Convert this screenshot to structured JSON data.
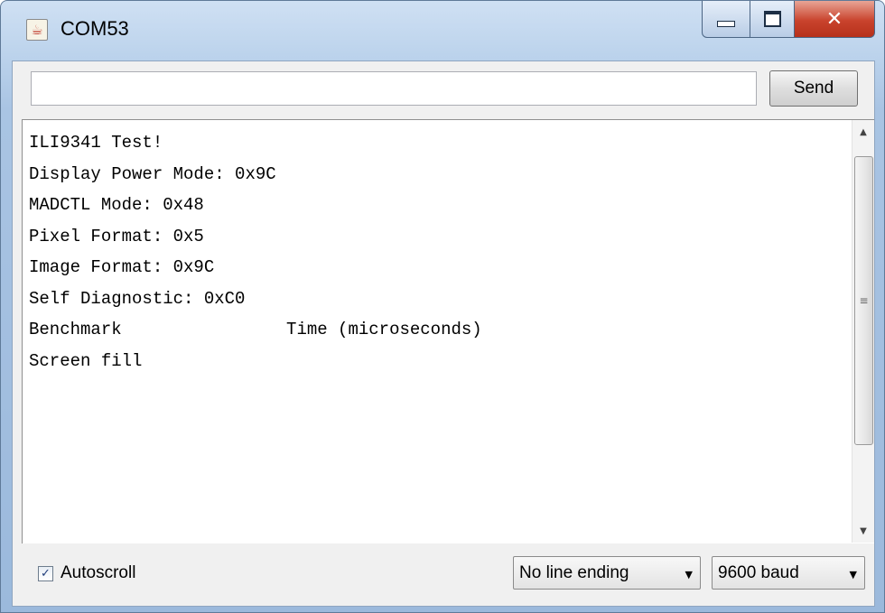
{
  "window": {
    "title": "COM53",
    "app_icon": "java-coffee-icon",
    "controls": {
      "minimize": "minimize-icon",
      "maximize": "maximize-icon",
      "close": "✕"
    }
  },
  "input": {
    "value": "",
    "placeholder": ""
  },
  "send_button": {
    "label": "Send"
  },
  "output": {
    "lines": [
      "ILI9341 Test!",
      "Display Power Mode: 0x9C",
      "MADCTL Mode: 0x48",
      "Pixel Format: 0x5",
      "Image Format: 0x9C",
      "Self Diagnostic: 0xC0",
      "Benchmark                Time (microseconds)",
      "Screen fill"
    ]
  },
  "scrollbar": {
    "up": "▲",
    "down": "▼",
    "grip": "≡"
  },
  "bottom": {
    "autoscroll": {
      "label": "Autoscroll",
      "checked": true,
      "check_glyph": "✓"
    },
    "line_ending": {
      "value": "No line ending",
      "arrow": "▼"
    },
    "baud": {
      "value": "9600 baud",
      "arrow": "▼"
    }
  }
}
